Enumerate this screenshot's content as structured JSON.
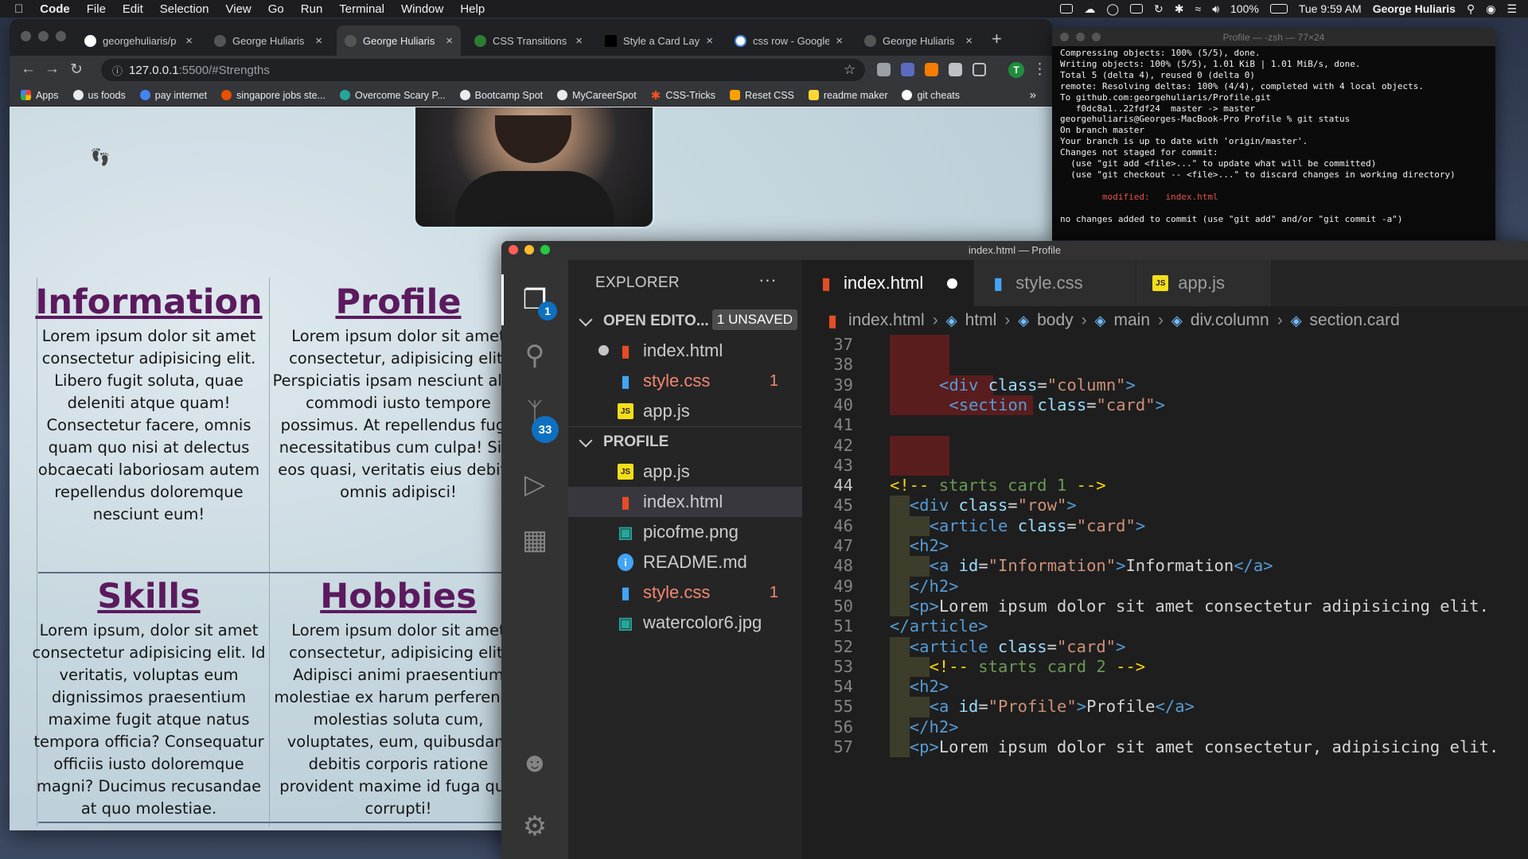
{
  "menubar": {
    "apple": "",
    "app": "Code",
    "items": [
      "File",
      "Edit",
      "Selection",
      "View",
      "Go",
      "Run",
      "Terminal",
      "Window",
      "Help"
    ],
    "battery": "100%",
    "clock": "Tue 9:59 AM",
    "user": "George Huliaris"
  },
  "browser": {
    "tabs": [
      {
        "title": "georgehuliaris/p"
      },
      {
        "title": "George Huliaris"
      },
      {
        "title": "George Huliaris"
      },
      {
        "title": "CSS Transitions"
      },
      {
        "title": "Style a Card Layo"
      },
      {
        "title": "css row - Google"
      },
      {
        "title": "George Huliaris"
      }
    ],
    "url_host": "127.0.0.1",
    "url_rest": ":5500/#Strengths",
    "avatar_letter": "T",
    "bookmarks": [
      "Apps",
      "us foods",
      "pay internet",
      "singapore jobs ste...",
      "Overcome Scary P...",
      "Bootcamp Spot",
      "MyCareerSpot",
      "CSS-Tricks",
      "Reset CSS",
      "readme maker",
      "git cheats"
    ]
  },
  "page": {
    "cards": [
      {
        "title": "Information",
        "text": "Lorem ipsum dolor sit amet consectetur adipisicing elit. Libero fugit soluta, quae deleniti atque quam! Consectetur facere, omnis quam quo nisi at delectus obcaecati laboriosam autem repellendus doloremque nesciunt eum!"
      },
      {
        "title": "Profile",
        "text": "Lorem ipsum dolor sit amet consectetur, adipisicing elit. Perspiciatis ipsam nesciunt alias commodi iusto tempore possimus. At repellendus fugit necessitatibus cum culpa! Sint eos quasi, veritatis eius debitis omnis adipisci!"
      },
      {
        "title": "Skills",
        "text": "Lorem ipsum, dolor sit amet consectetur adipisicing elit. Id veritatis, voluptas eum dignissimos praesentium maxime fugit atque natus tempora officia? Consequatur officiis iusto doloremque magni? Ducimus recusandae at quo molestiae."
      },
      {
        "title": "Hobbies",
        "text": "Lorem ipsum dolor sit amet consectetur, adipisicing elit. Adipisci animi praesentium molestiae ex harum perferendis molestias soluta cum, voluptates, eum, quibusdam debitis corporis ratione provident maxime id fuga quis corrupti!"
      }
    ]
  },
  "terminal": {
    "title": "Profile — -zsh — 77×24",
    "lines": [
      "Compressing objects: 100% (5/5), done.",
      "Writing objects: 100% (5/5), 1.01 KiB | 1.01 MiB/s, done.",
      "Total 5 (delta 4), reused 0 (delta 0)",
      "remote: Resolving deltas: 100% (4/4), completed with 4 local objects.",
      "To github.com:georgehuliaris/Profile.git",
      "   f0dc8a1..22fdf24  master -> master",
      "georgehuliaris@Georges-MacBook-Pro Profile % git status",
      "On branch master",
      "Your branch is up to date with 'origin/master'.",
      "",
      "Changes not staged for commit:",
      "  (use \"git add <file>...\" to update what will be committed)",
      "  (use \"git checkout -- <file>...\" to discard changes in working directory)",
      "",
      "no changes added to commit (use \"git add\" and/or \"git commit -a\")"
    ],
    "modified_label": "        modified:   index.html"
  },
  "vscode": {
    "window_title": "index.html — Profile",
    "explorer_label": "EXPLORER",
    "explorer_badge": "1",
    "scm_badge": "33",
    "open_editors_label": "OPEN EDITO...",
    "unsaved_label": "1 UNSAVED",
    "open_editors": [
      {
        "name": "index.html",
        "type": "html",
        "dirty": true
      },
      {
        "name": "style.css",
        "type": "css",
        "errors": "1"
      },
      {
        "name": "app.js",
        "type": "js"
      }
    ],
    "profile_label": "PROFILE",
    "files": [
      {
        "name": "app.js",
        "type": "js"
      },
      {
        "name": "index.html",
        "type": "html",
        "selected": true
      },
      {
        "name": "picofme.png",
        "type": "img"
      },
      {
        "name": "README.md",
        "type": "info"
      },
      {
        "name": "style.css",
        "type": "css",
        "errors": "1"
      },
      {
        "name": "watercolor6.jpg",
        "type": "img"
      }
    ],
    "tabs": [
      {
        "name": "index.html",
        "type": "html",
        "active": true,
        "dirty": true
      },
      {
        "name": "style.css",
        "type": "css"
      },
      {
        "name": "app.js",
        "type": "js"
      }
    ],
    "breadcrumbs": [
      "index.html",
      "html",
      "body",
      "main",
      "div.column",
      "section.card"
    ],
    "code_lines": [
      {
        "n": "37",
        "text": ""
      },
      {
        "n": "38",
        "text": ""
      },
      {
        "n": "39",
        "text": "<div class=\"column\">"
      },
      {
        "n": "40",
        "text": "<section class=\"card\">"
      },
      {
        "n": "41",
        "text": ""
      },
      {
        "n": "42",
        "text": ""
      },
      {
        "n": "43",
        "text": ""
      },
      {
        "n": "44",
        "text": "<!-- starts card 1 -->"
      },
      {
        "n": "45",
        "text": "<div class=\"row\">"
      },
      {
        "n": "46",
        "text": "<article class=\"card\">"
      },
      {
        "n": "47",
        "text": "<h2>"
      },
      {
        "n": "48",
        "text": "<a id=\"Information\">Information</a>"
      },
      {
        "n": "49",
        "text": "</h2>"
      },
      {
        "n": "50",
        "text": "<p>Lorem ipsum dolor sit amet consectetur adipisicing elit."
      },
      {
        "n": "51",
        "text": "</article>"
      },
      {
        "n": "52",
        "text": "<article class=\"card\">"
      },
      {
        "n": "53",
        "text": "<!-- starts card 2 -->"
      },
      {
        "n": "54",
        "text": "<h2>"
      },
      {
        "n": "55",
        "text": "<a id=\"Profile\">Profile</a>"
      },
      {
        "n": "56",
        "text": "</h2>"
      },
      {
        "n": "57",
        "text": "<p>Lorem ipsum dolor sit amet consectetur, adipisicing elit."
      }
    ]
  }
}
